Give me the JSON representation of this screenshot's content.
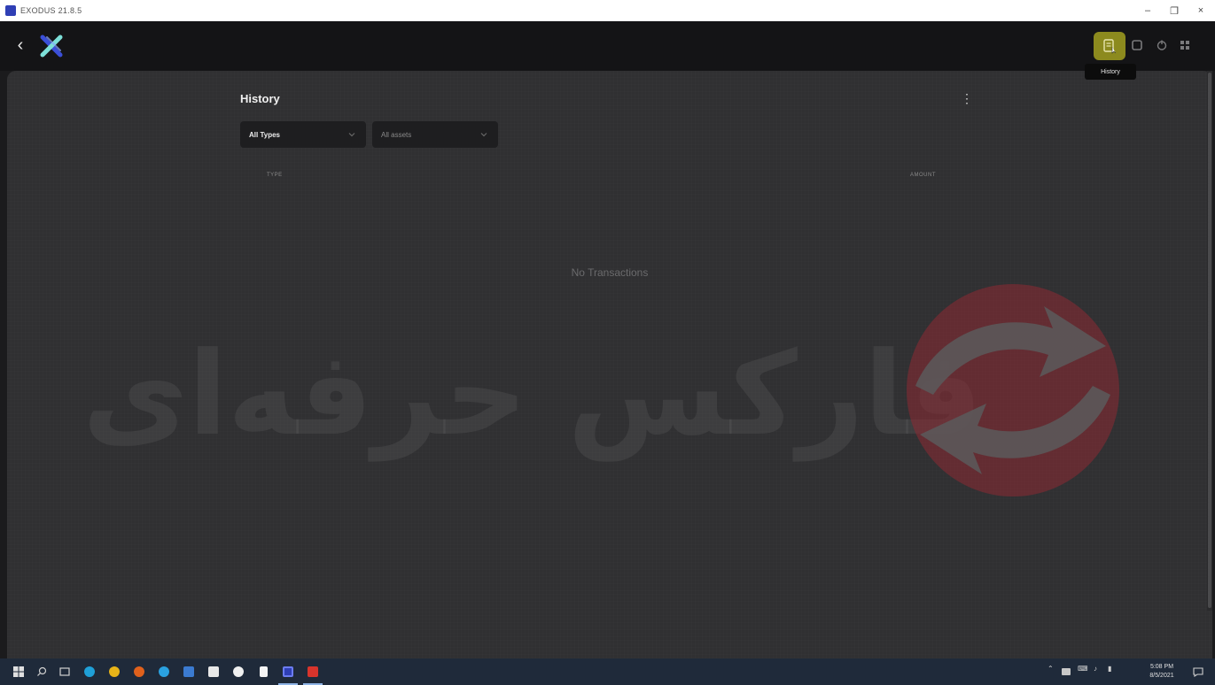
{
  "window": {
    "title": "EXODUS 21.8.5"
  },
  "header": {
    "active_tooltip": "History",
    "colors": {
      "active_bg": "#8c8a1e",
      "logo_primary": "#3b4fd8",
      "logo_secondary": "#7de0d8"
    }
  },
  "history": {
    "title": "History",
    "filters": {
      "type": "All Types",
      "asset": "All assets"
    },
    "columns": {
      "type": "TYPE",
      "amount": "AMOUNT"
    },
    "empty_message": "No Transactions"
  },
  "watermark": {
    "text": "فارکس حرفه‌ای",
    "logo_color": "#8e2a33"
  },
  "taskbar": {
    "apps": [
      "start",
      "search",
      "task-view",
      "edge",
      "chrome",
      "firefox",
      "app-blue",
      "store-grid",
      "store-bag",
      "circle-app",
      "files",
      "exodus",
      "red-app"
    ],
    "tray_icons": [
      "chevron-up",
      "network",
      "keyboard",
      "volume",
      "battery"
    ],
    "time": "5:08 PM",
    "date": "8/5/2021"
  }
}
